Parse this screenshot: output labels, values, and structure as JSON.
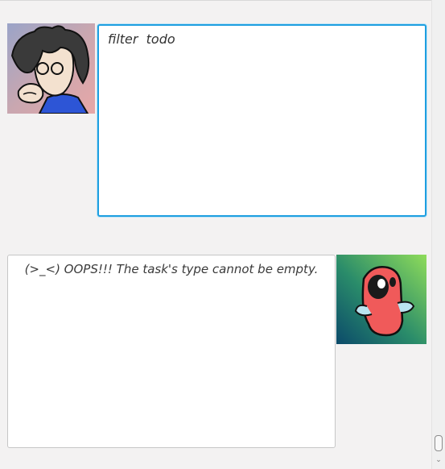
{
  "dialog": {
    "user_message": "filter  todo",
    "bot_message": "(>_<) OOPS!!! The task's type cannot be empty."
  },
  "avatars": {
    "user": "user-avatar-cartoon",
    "bot": "bot-avatar-red-creature"
  },
  "colors": {
    "user_bubble_border": "#1e9fe0",
    "bot_bubble_border": "#c6c6c6",
    "background": "#f3f2f2"
  },
  "scrollbar": {
    "arrow_down": "⌄"
  }
}
